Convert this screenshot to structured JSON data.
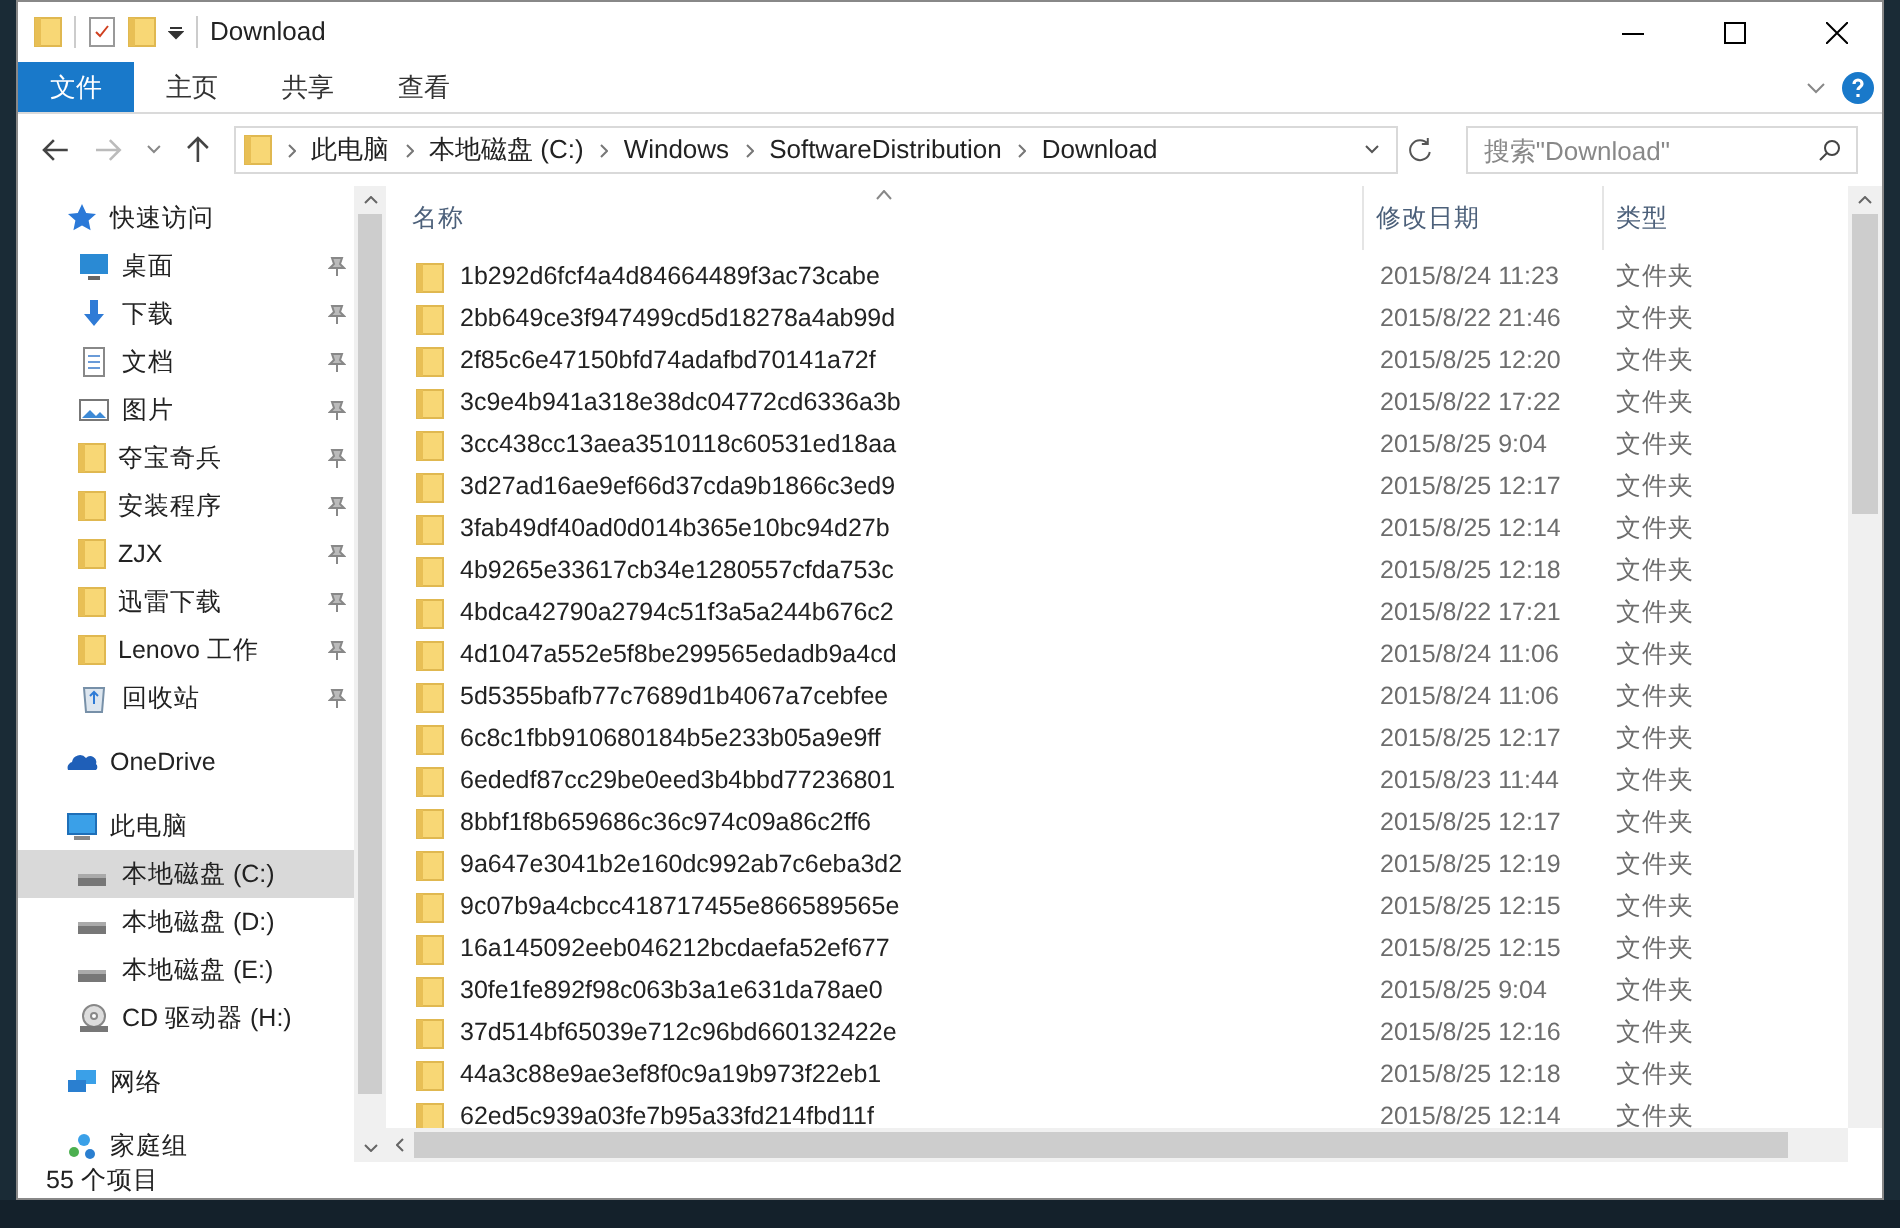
{
  "window": {
    "title": "Download"
  },
  "ribbon_tabs": [
    {
      "label": "文件",
      "selected": true
    },
    {
      "label": "主页",
      "selected": false
    },
    {
      "label": "共享",
      "selected": false
    },
    {
      "label": "查看",
      "selected": false
    }
  ],
  "breadcrumb": [
    "此电脑",
    "本地磁盘 (C:)",
    "Windows",
    "SoftwareDistribution",
    "Download"
  ],
  "search": {
    "placeholder": "搜索\"Download\""
  },
  "sidebar": {
    "items": [
      {
        "kind": "quick",
        "label": "快速访问",
        "pinned": false,
        "selected": false
      },
      {
        "kind": "desktop",
        "label": "桌面",
        "pinned": true,
        "selected": false
      },
      {
        "kind": "download",
        "label": "下载",
        "pinned": true,
        "selected": false
      },
      {
        "kind": "document",
        "label": "文档",
        "pinned": true,
        "selected": false
      },
      {
        "kind": "picture",
        "label": "图片",
        "pinned": true,
        "selected": false
      },
      {
        "kind": "folder",
        "label": "夺宝奇兵",
        "pinned": true,
        "selected": false
      },
      {
        "kind": "folder",
        "label": "安装程序",
        "pinned": true,
        "selected": false
      },
      {
        "kind": "folder",
        "label": "ZJX",
        "pinned": true,
        "selected": false
      },
      {
        "kind": "folder",
        "label": "迅雷下载",
        "pinned": true,
        "selected": false
      },
      {
        "kind": "folder",
        "label": "Lenovo 工作",
        "pinned": true,
        "selected": false
      },
      {
        "kind": "recycle",
        "label": "回收站",
        "pinned": true,
        "selected": false
      },
      {
        "kind": "onedrive",
        "label": "OneDrive",
        "pinned": false,
        "selected": false
      },
      {
        "kind": "pc",
        "label": "此电脑",
        "pinned": false,
        "selected": false
      },
      {
        "kind": "drive",
        "label": "本地磁盘 (C:)",
        "pinned": false,
        "selected": true
      },
      {
        "kind": "drive",
        "label": "本地磁盘 (D:)",
        "pinned": false,
        "selected": false
      },
      {
        "kind": "drive",
        "label": "本地磁盘 (E:)",
        "pinned": false,
        "selected": false
      },
      {
        "kind": "cd",
        "label": "CD 驱动器 (H:)",
        "pinned": false,
        "selected": false
      },
      {
        "kind": "network",
        "label": "网络",
        "pinned": false,
        "selected": false
      },
      {
        "kind": "homegroup",
        "label": "家庭组",
        "pinned": false,
        "selected": false
      }
    ]
  },
  "table": {
    "columns": [
      "名称",
      "修改日期",
      "类型"
    ],
    "rows": [
      [
        "1b292d6fcf4a4d84664489f3ac73cabe",
        "2015/8/24 11:23",
        "文件夹"
      ],
      [
        "2bb649ce3f947499cd5d18278a4ab99d",
        "2015/8/22 21:46",
        "文件夹"
      ],
      [
        "2f85c6e47150bfd74adafbd70141a72f",
        "2015/8/25 12:20",
        "文件夹"
      ],
      [
        "3c9e4b941a318e38dc04772cd6336a3b",
        "2015/8/22 17:22",
        "文件夹"
      ],
      [
        "3cc438cc13aea3510118c60531ed18aa",
        "2015/8/25 9:04",
        "文件夹"
      ],
      [
        "3d27ad16ae9ef66d37cda9b1866c3ed9",
        "2015/8/25 12:17",
        "文件夹"
      ],
      [
        "3fab49df40ad0d014b365e10bc94d27b",
        "2015/8/25 12:14",
        "文件夹"
      ],
      [
        "4b9265e33617cb34e1280557cfda753c",
        "2015/8/25 12:18",
        "文件夹"
      ],
      [
        "4bdca42790a2794c51f3a5a244b676c2",
        "2015/8/22 17:21",
        "文件夹"
      ],
      [
        "4d1047a552e5f8be299565edadb9a4cd",
        "2015/8/24 11:06",
        "文件夹"
      ],
      [
        "5d5355bafb77c7689d1b4067a7cebfee",
        "2015/8/24 11:06",
        "文件夹"
      ],
      [
        "6c8c1fbb910680184b5e233b05a9e9ff",
        "2015/8/25 12:17",
        "文件夹"
      ],
      [
        "6ededf87cc29be0eed3b4bbd77236801",
        "2015/8/23 11:44",
        "文件夹"
      ],
      [
        "8bbf1f8b659686c36c974c09a86c2ff6",
        "2015/8/25 12:17",
        "文件夹"
      ],
      [
        "9a647e3041b2e160dc992ab7c6eba3d2",
        "2015/8/25 12:19",
        "文件夹"
      ],
      [
        "9c07b9a4cbcc418717455e866589565e",
        "2015/8/25 12:15",
        "文件夹"
      ],
      [
        "16a145092eeb046212bcdaefa52ef677",
        "2015/8/25 12:15",
        "文件夹"
      ],
      [
        "30fe1fe892f98c063b3a1e631da78ae0",
        "2015/8/25 9:04",
        "文件夹"
      ],
      [
        "37d514bf65039e712c96bd660132422e",
        "2015/8/25 12:16",
        "文件夹"
      ],
      [
        "44a3c88e9ae3ef8f0c9a19b973f22eb1",
        "2015/8/25 12:18",
        "文件夹"
      ],
      [
        "62ed5c939a03fe7b95a33fd214fbd11f",
        "2015/8/25 12:14",
        "文件夹"
      ]
    ]
  },
  "status_bar": {
    "count": "55 个项目"
  }
}
